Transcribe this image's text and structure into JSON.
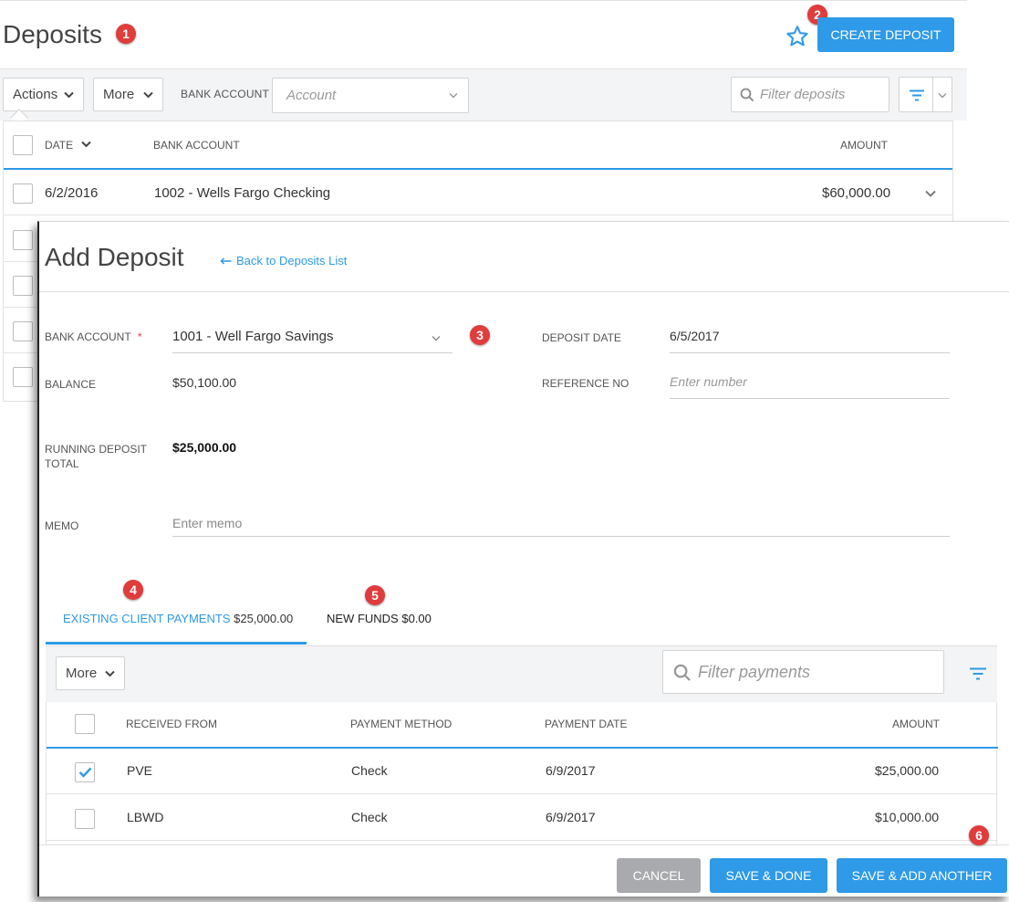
{
  "list_page": {
    "title": "Deposits",
    "create_button": "CREATE DEPOSIT",
    "actions_label": "Actions",
    "more_label": "More",
    "bank_account_label": "BANK ACCOUNT",
    "account_placeholder": "Account",
    "filter_placeholder": "Filter deposits",
    "columns": [
      "DATE",
      "BANK ACCOUNT",
      "AMOUNT"
    ],
    "rows": [
      {
        "date": "6/2/2016",
        "bank_account": "1002 - Wells Fargo Checking",
        "amount": "$60,000.00"
      }
    ]
  },
  "badges": [
    "1",
    "2",
    "3",
    "4",
    "5",
    "6"
  ],
  "modal": {
    "title": "Add Deposit",
    "back_link": "Back to Deposits List",
    "fields": {
      "bank_account_label": "BANK ACCOUNT",
      "required_mark": "*",
      "bank_account_value": "1001 - Well Fargo Savings",
      "balance_label": "BALANCE",
      "balance_value": "$50,100.00",
      "running_total_label": "RUNNING DEPOSIT TOTAL",
      "running_total_value": "$25,000.00",
      "memo_label": "MEMO",
      "memo_placeholder": "Enter memo",
      "deposit_date_label": "DEPOSIT DATE",
      "deposit_date_value": "6/5/2017",
      "reference_label": "REFERENCE NO",
      "reference_placeholder": "Enter number"
    },
    "tabs": [
      {
        "label": "EXISTING CLIENT PAYMENTS",
        "amount": "$25,000.00",
        "active": true
      },
      {
        "label": "NEW FUNDS",
        "amount": "$0.00",
        "active": false
      }
    ],
    "payments": {
      "more_label": "More",
      "filter_placeholder": "Filter payments",
      "columns": [
        "RECEIVED FROM",
        "PAYMENT METHOD",
        "PAYMENT DATE",
        "AMOUNT"
      ],
      "rows": [
        {
          "checked": true,
          "received_from": "PVE",
          "method": "Check",
          "date": "6/9/2017",
          "amount": "$25,000.00"
        },
        {
          "checked": false,
          "received_from": "LBWD",
          "method": "Check",
          "date": "6/9/2017",
          "amount": "$10,000.00"
        }
      ]
    },
    "footer": {
      "cancel": "CANCEL",
      "save_done": "SAVE & DONE",
      "save_add": "SAVE & ADD ANOTHER"
    }
  },
  "colors": {
    "accent": "#2e9ae8",
    "badge": "#e03c3c",
    "cancel": "#a9aaad",
    "required": "#e03c3c"
  }
}
